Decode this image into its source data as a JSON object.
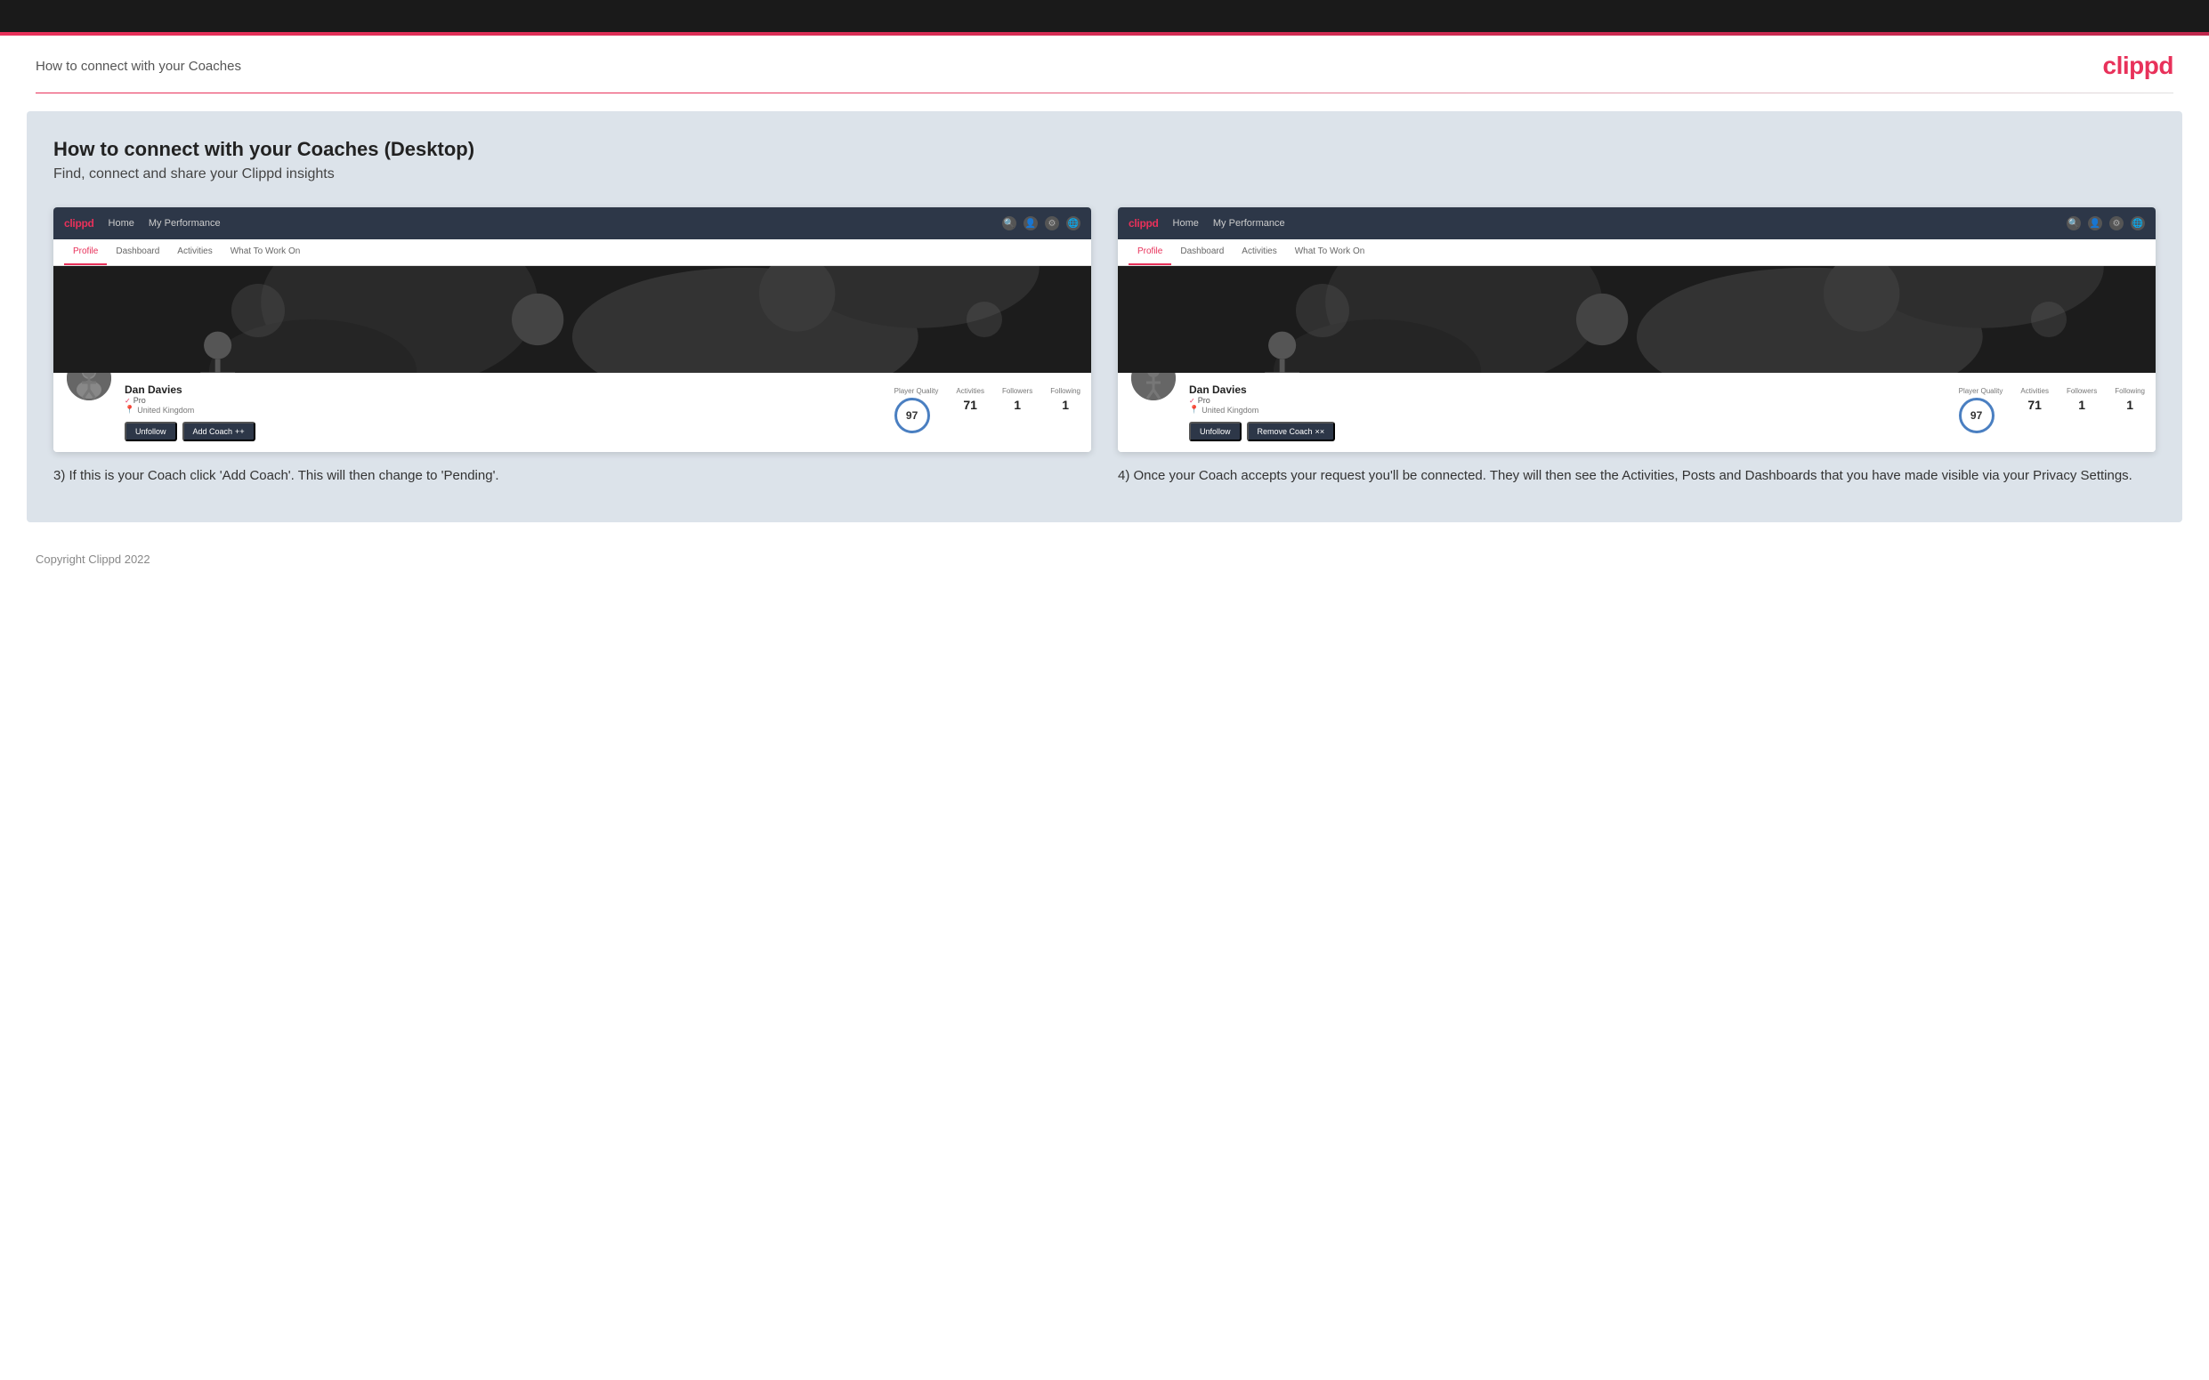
{
  "page": {
    "top_bar": "",
    "header": {
      "title": "How to connect with your Coaches",
      "logo": "clippd"
    },
    "main": {
      "section_title": "How to connect with your Coaches (Desktop)",
      "section_subtitle": "Find, connect and share your Clippd insights",
      "left_panel": {
        "nav": {
          "logo": "clippd",
          "items": [
            "Home",
            "My Performance"
          ]
        },
        "tabs": [
          "Profile",
          "Dashboard",
          "Activities",
          "What To Work On"
        ],
        "active_tab": "Profile",
        "user": {
          "name": "Dan Davies",
          "role": "Pro",
          "location": "United Kingdom",
          "quality_score": 97,
          "activities": 71,
          "followers": 1,
          "following": 1,
          "quality_label": "Player Quality",
          "activities_label": "Activities",
          "followers_label": "Followers",
          "following_label": "Following"
        },
        "buttons": {
          "unfollow": "Unfollow",
          "add_coach": "Add Coach"
        },
        "description": "3) If this is your Coach click 'Add Coach'. This will then change to 'Pending'."
      },
      "right_panel": {
        "nav": {
          "logo": "clippd",
          "items": [
            "Home",
            "My Performance"
          ]
        },
        "tabs": [
          "Profile",
          "Dashboard",
          "Activities",
          "What To Work On"
        ],
        "active_tab": "Profile",
        "user": {
          "name": "Dan Davies",
          "role": "Pro",
          "location": "United Kingdom",
          "quality_score": 97,
          "activities": 71,
          "followers": 1,
          "following": 1,
          "quality_label": "Player Quality",
          "activities_label": "Activities",
          "followers_label": "Followers",
          "following_label": "Following"
        },
        "buttons": {
          "unfollow": "Unfollow",
          "remove_coach": "Remove Coach"
        },
        "description": "4) Once your Coach accepts your request you'll be connected. They will then see the Activities, Posts and Dashboards that you have made visible via your Privacy Settings."
      }
    },
    "footer": {
      "copyright": "Copyright Clippd 2022"
    }
  }
}
